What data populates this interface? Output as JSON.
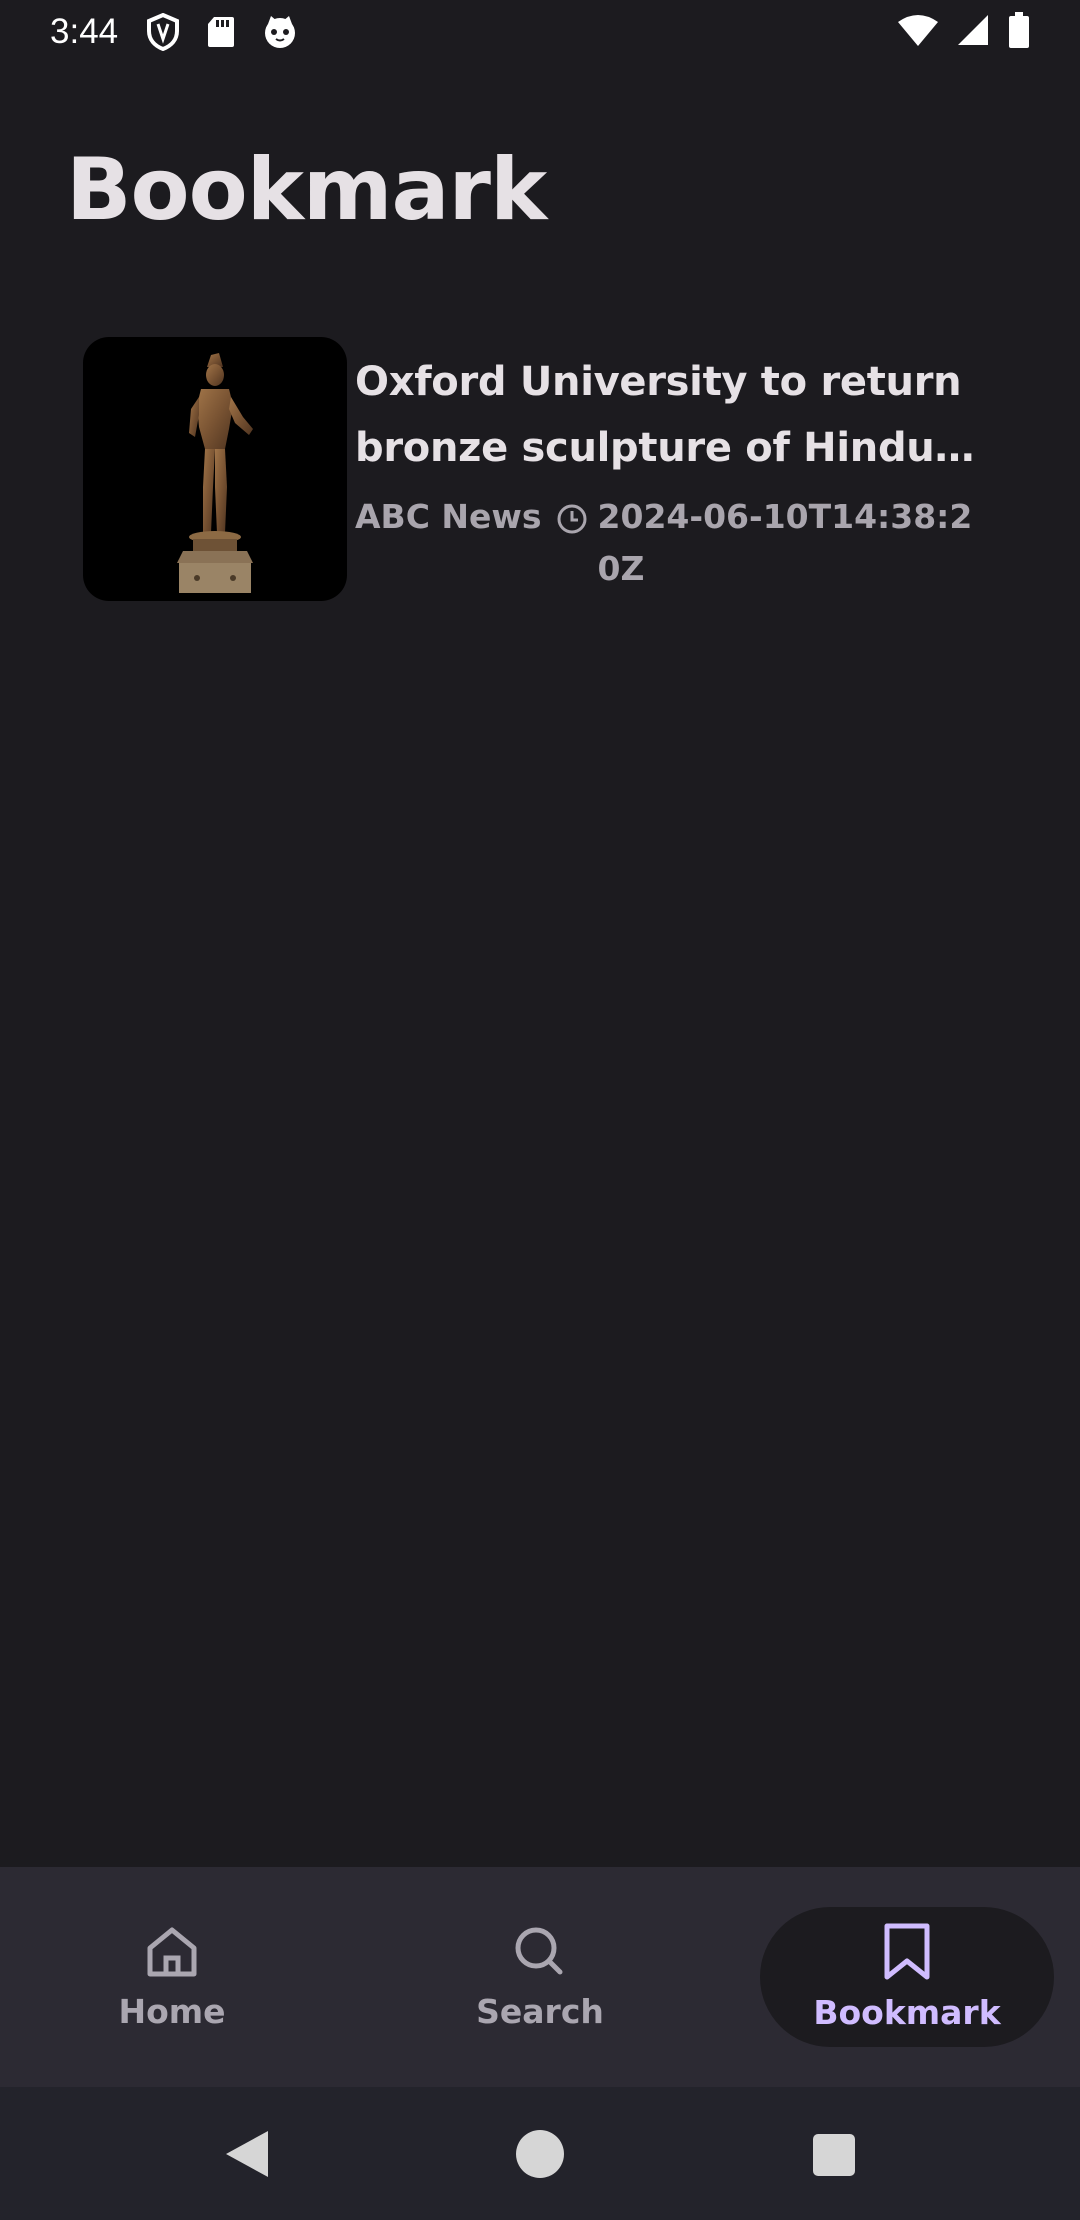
{
  "status_bar": {
    "time": "3:44",
    "icons": [
      "shield-icon",
      "sd-card-icon",
      "cat-face-icon",
      "wifi-icon",
      "cell-signal-icon",
      "battery-icon"
    ]
  },
  "header": {
    "title": "Bookmark"
  },
  "bookmarks": [
    {
      "title": "Oxford University to return bronze sculpture of Hindu ...",
      "source": "ABC News",
      "published": "2024-06-10T14:38:20Z",
      "image": "bronze-sculpture-thumbnail"
    }
  ],
  "bottom_nav": {
    "items": [
      {
        "label": "Home",
        "icon": "home-icon"
      },
      {
        "label": "Search",
        "icon": "search-icon"
      },
      {
        "label": "Bookmark",
        "icon": "bookmark-icon",
        "active": true
      }
    ]
  },
  "system_nav": [
    "back-icon",
    "home-circle-icon",
    "recents-icon"
  ],
  "colors": {
    "background": "#1c1b1f",
    "nav_background": "#2c2a33",
    "accent": "#d0bcff",
    "muted_text": "#a9a5ad"
  }
}
